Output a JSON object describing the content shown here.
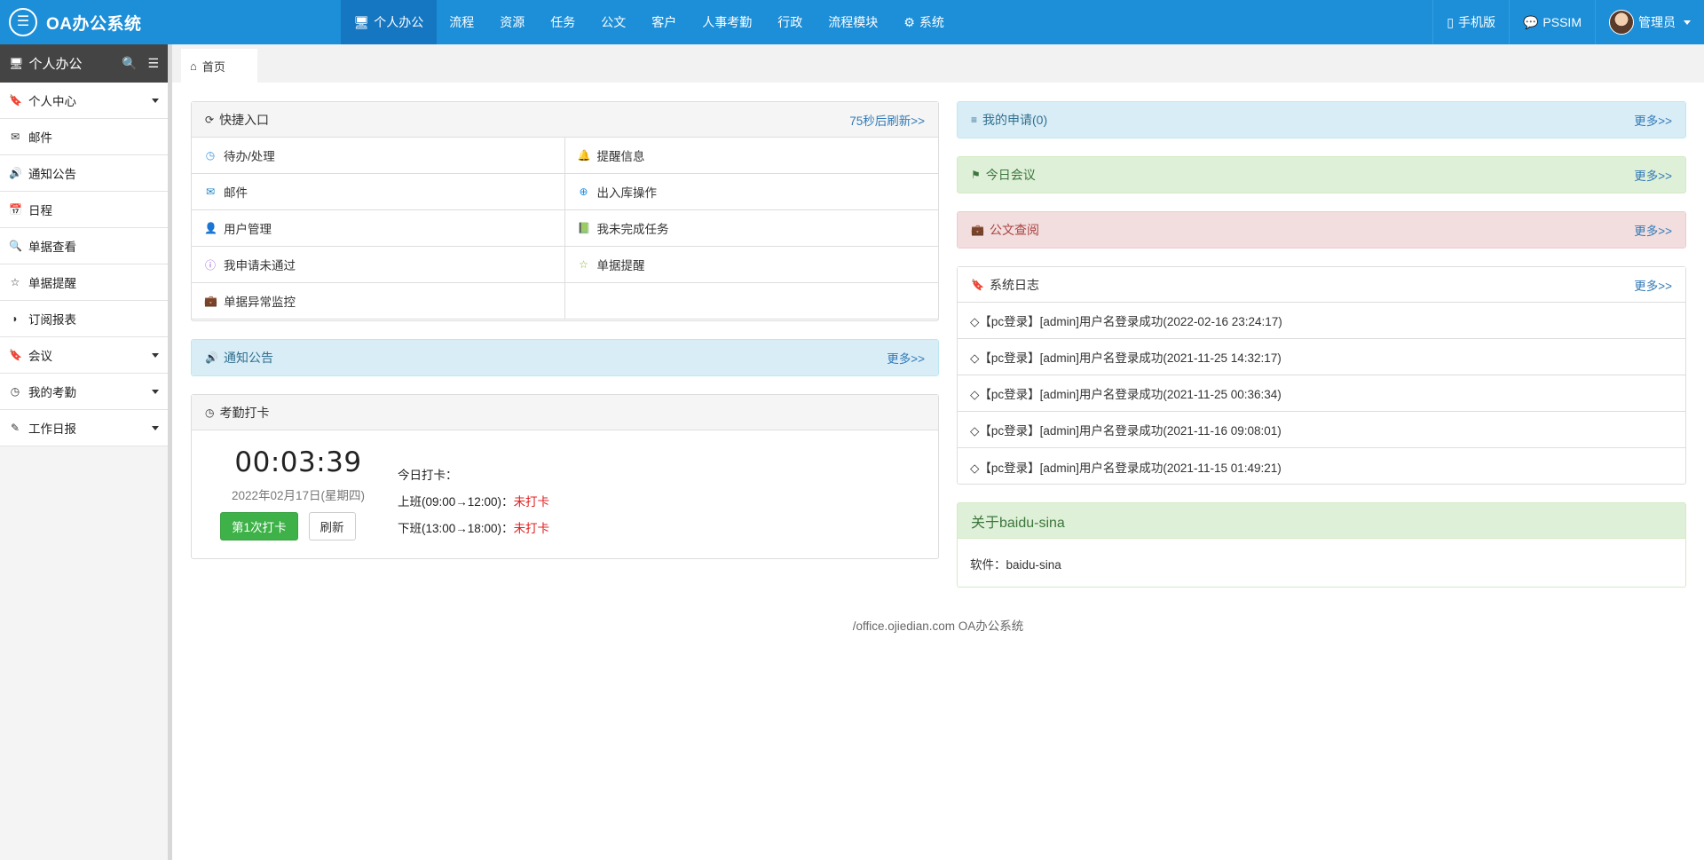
{
  "brand": {
    "title": "OA办公系统",
    "logo_icon": "chat-list-icon"
  },
  "topnav": [
    {
      "label": "个人办公",
      "icon": "monitor-icon",
      "active": true
    },
    {
      "label": "流程"
    },
    {
      "label": "资源"
    },
    {
      "label": "任务"
    },
    {
      "label": "公文"
    },
    {
      "label": "客户"
    },
    {
      "label": "人事考勤"
    },
    {
      "label": "行政"
    },
    {
      "label": "流程模块"
    },
    {
      "label": "系统",
      "icon": "gear-icon"
    }
  ],
  "top_right": {
    "mobile": "手机版",
    "im": "PSSIM",
    "user": "管理员"
  },
  "sidebar": {
    "title": "个人办公",
    "items": [
      {
        "label": "个人中心",
        "icon": "bookmark-icon",
        "caret": true
      },
      {
        "label": "邮件",
        "icon": "envelope-icon"
      },
      {
        "label": "通知公告",
        "icon": "volume-icon"
      },
      {
        "label": "日程",
        "icon": "calendar-icon"
      },
      {
        "label": "单据查看",
        "icon": "search-icon"
      },
      {
        "label": "单据提醒",
        "icon": "star-icon"
      },
      {
        "label": "订阅报表",
        "icon": "rss-icon"
      },
      {
        "label": "会议",
        "icon": "bookmark-icon",
        "caret": true
      },
      {
        "label": "我的考勤",
        "icon": "clock-icon",
        "caret": true
      },
      {
        "label": "工作日报",
        "icon": "edit-icon",
        "caret": true
      }
    ]
  },
  "tabs": [
    {
      "label": "首页",
      "icon": "home-icon"
    }
  ],
  "quick": {
    "title": "快捷入口",
    "refresh": "75秒后刷新>>",
    "items": [
      {
        "label": "待办/处理",
        "icon": "clock-icon",
        "color": "#3b9ae1"
      },
      {
        "label": "提醒信息",
        "icon": "bell-icon",
        "color": "#e8a33a"
      },
      {
        "label": "邮件",
        "icon": "envelope-icon",
        "color": "#1a7fc4"
      },
      {
        "label": "出入库操作",
        "icon": "plus-circle-icon",
        "color": "#1a8fe0"
      },
      {
        "label": "用户管理",
        "icon": "user-icon",
        "color": "#4a90d9"
      },
      {
        "label": "我未完成任务",
        "icon": "book-icon",
        "color": "#8bb33a"
      },
      {
        "label": "我申请未通过",
        "icon": "info-icon",
        "color": "#9b59d0"
      },
      {
        "label": "单据提醒",
        "icon": "star-icon",
        "color": "#8bb33a"
      },
      {
        "label": "单据异常监控",
        "icon": "briefcase-icon",
        "color": "#a52a2a"
      },
      {
        "label": ""
      }
    ]
  },
  "notice": {
    "title": "通知公告",
    "more": "更多>>"
  },
  "attendance": {
    "title": "考勤打卡",
    "time": "00:03:39",
    "date": "2022年02月17日(星期四)",
    "punch_label": "第1次打卡",
    "refresh_label": "刷新",
    "today_label": "今日打卡：",
    "morning_label": "上班(09:00→12:00)：",
    "morning_status": "未打卡",
    "evening_label": "下班(13:00→18:00)：",
    "evening_status": "未打卡"
  },
  "my_apply": {
    "title": "我的申请(0)",
    "more": "更多>>"
  },
  "meeting": {
    "title": "今日会议",
    "more": "更多>>"
  },
  "docs": {
    "title": "公文查阅",
    "more": "更多>>"
  },
  "syslog": {
    "title": "系统日志",
    "more": "更多>>",
    "rows": [
      "◇【pc登录】[admin]用户名登录成功(2022-02-16 23:24:17)",
      "◇【pc登录】[admin]用户名登录成功(2021-11-25 14:32:17)",
      "◇【pc登录】[admin]用户名登录成功(2021-11-25 00:36:34)",
      "◇【pc登录】[admin]用户名登录成功(2021-11-16 09:08:01)",
      "◇【pc登录】[admin]用户名登录成功(2021-11-15 01:49:21)"
    ]
  },
  "about": {
    "title": "关于baidu-sina",
    "body": "软件：baidu-sina"
  },
  "footer": "/office.ojiedian.com  OA办公系统"
}
